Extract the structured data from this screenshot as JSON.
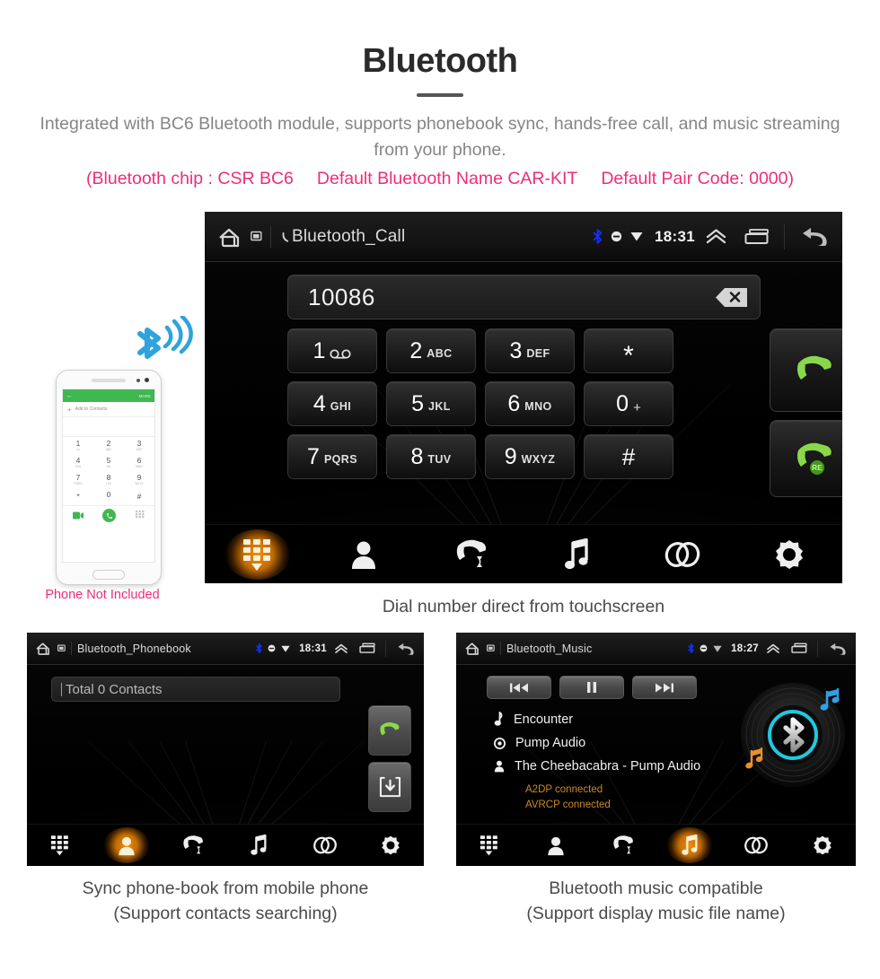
{
  "header": {
    "title": "Bluetooth",
    "subtitle": "Integrated with BC6 Bluetooth module, supports phonebook sync, hands-free call, and music streaming from your phone.",
    "specs": [
      "(Bluetooth chip : CSR BC6",
      "Default Bluetooth Name CAR-KIT",
      "Default Pair Code: 0000)"
    ],
    "accent_color": "#ee2d7a",
    "text_color": "#858585"
  },
  "phone_mock": {
    "caption": "Phone Not Included",
    "app_bar_back": "←",
    "app_bar_more": "MORE",
    "add_contacts": "Add to Contacts",
    "add_plus": "+",
    "keys": [
      {
        "digit": "1",
        "letters": "oo"
      },
      {
        "digit": "2",
        "letters": "ABC"
      },
      {
        "digit": "3",
        "letters": "DEF"
      },
      {
        "digit": "4",
        "letters": "GHI"
      },
      {
        "digit": "5",
        "letters": "JKL"
      },
      {
        "digit": "6",
        "letters": "MNO"
      },
      {
        "digit": "7",
        "letters": "PQRS"
      },
      {
        "digit": "8",
        "letters": "TUV"
      },
      {
        "digit": "9",
        "letters": "WXYZ"
      },
      {
        "digit": "*",
        "letters": ""
      },
      {
        "digit": "0",
        "letters": "+"
      },
      {
        "digit": "#",
        "letters": ""
      }
    ]
  },
  "main_screen": {
    "caption": "Dial number direct from touchscreen",
    "topbar": {
      "title": "Bluetooth_Call",
      "time": "18:31",
      "home_icon": "home-icon",
      "window_icon": "window-icon",
      "call-icon": "phone-handset-icon",
      "status_icons": [
        "bluetooth-icon",
        "mute-icon",
        "wifi-icon"
      ],
      "nav_icons": [
        "chevron-up-icon",
        "recent-apps-icon",
        "back-icon"
      ]
    },
    "dial": {
      "number": "10086",
      "backspace_icon": "backspace-icon"
    },
    "keypad": [
      {
        "digit": "1",
        "letters": "",
        "voicemail": true
      },
      {
        "digit": "2",
        "letters": "ABC"
      },
      {
        "digit": "3",
        "letters": "DEF"
      },
      {
        "digit": "*",
        "letters": ""
      },
      {
        "digit": "4",
        "letters": "GHI"
      },
      {
        "digit": "5",
        "letters": "JKL"
      },
      {
        "digit": "6",
        "letters": "MNO"
      },
      {
        "digit": "0",
        "letters": "+"
      },
      {
        "digit": "7",
        "letters": "PQRS"
      },
      {
        "digit": "8",
        "letters": "TUV"
      },
      {
        "digit": "9",
        "letters": "WXYZ"
      },
      {
        "digit": "#",
        "letters": ""
      }
    ],
    "call_button": "call-icon",
    "redial_button": "redial-icon",
    "redial_badge": "RE",
    "navbar": [
      {
        "name": "keypad",
        "icon": "keypad-icon",
        "active": true
      },
      {
        "name": "contacts",
        "icon": "person-icon",
        "active": false
      },
      {
        "name": "call-history",
        "icon": "call-history-icon",
        "active": false
      },
      {
        "name": "music",
        "icon": "music-note-icon",
        "active": false
      },
      {
        "name": "pair",
        "icon": "link-icon",
        "active": false
      },
      {
        "name": "settings",
        "icon": "gear-icon",
        "active": false
      }
    ]
  },
  "phonebook_screen": {
    "caption_line1": "Sync phone-book from mobile phone",
    "caption_line2": "(Support contacts searching)",
    "topbar": {
      "title": "Bluetooth_Phonebook",
      "time": "18:31"
    },
    "search_placeholder": "Total 0 Contacts",
    "side_buttons": [
      {
        "name": "call",
        "icon": "call-icon"
      },
      {
        "name": "download-contacts",
        "icon": "download-icon"
      }
    ],
    "navbar": [
      {
        "name": "keypad",
        "icon": "keypad-icon",
        "active": false
      },
      {
        "name": "contacts",
        "icon": "person-icon",
        "active": true
      },
      {
        "name": "call-history",
        "icon": "call-history-icon",
        "active": false
      },
      {
        "name": "music",
        "icon": "music-note-icon",
        "active": false
      },
      {
        "name": "pair",
        "icon": "link-icon",
        "active": false
      },
      {
        "name": "settings",
        "icon": "gear-icon",
        "active": false
      }
    ]
  },
  "music_screen": {
    "caption_line1": "Bluetooth music compatible",
    "caption_line2": "(Support display music file name)",
    "topbar": {
      "title": "Bluetooth_Music",
      "time": "18:27"
    },
    "controls": [
      {
        "name": "previous",
        "icon": "previous-track-icon"
      },
      {
        "name": "pause",
        "icon": "pause-icon"
      },
      {
        "name": "next",
        "icon": "next-track-icon"
      }
    ],
    "track": {
      "title": "Encounter",
      "album": "Pump Audio",
      "artist": "The Cheebacabra - Pump Audio",
      "title_icon": "note-icon",
      "album_icon": "disc-icon",
      "artist_icon": "person-icon"
    },
    "status": [
      "A2DP connected",
      "AVRCP connected"
    ],
    "status_color": "#c98a22",
    "album_art": "bluetooth-vinyl-icon",
    "navbar": [
      {
        "name": "keypad",
        "icon": "keypad-icon",
        "active": false
      },
      {
        "name": "contacts",
        "icon": "person-icon",
        "active": false
      },
      {
        "name": "call-history",
        "icon": "call-history-icon",
        "active": false
      },
      {
        "name": "music",
        "icon": "music-note-icon",
        "active": true
      },
      {
        "name": "pair",
        "icon": "link-icon",
        "active": false
      },
      {
        "name": "settings",
        "icon": "gear-icon",
        "active": false
      }
    ]
  }
}
